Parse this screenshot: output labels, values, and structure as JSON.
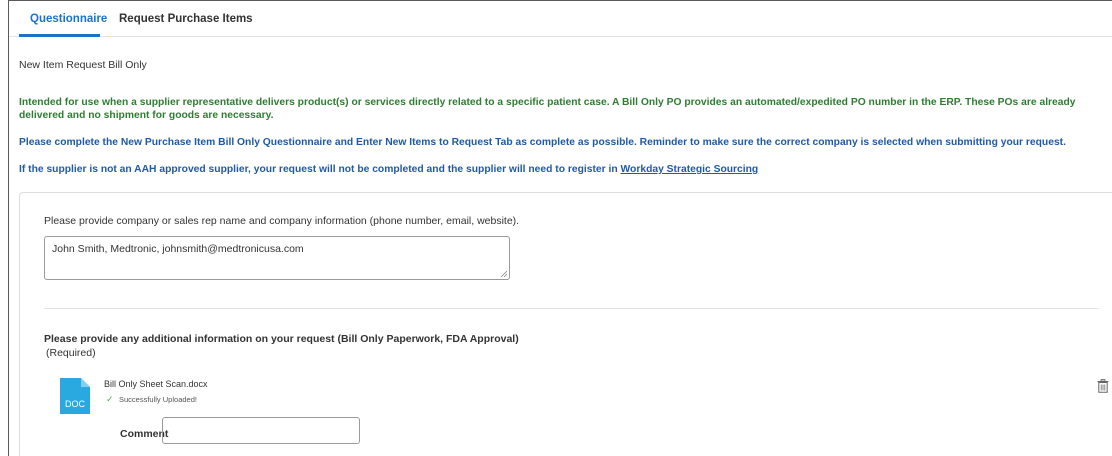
{
  "tabs": [
    {
      "label": "Questionnaire",
      "active": true
    },
    {
      "label": "Request Purchase Items",
      "active": false
    }
  ],
  "subtitle": "New Item Request Bill Only",
  "notices": {
    "intended_use": "Intended for use when a supplier representative delivers product(s) or services directly related to a specific patient case. A Bill Only PO provides an automated/expedited PO number in the ERP. These POs are already delivered and no shipment for goods are necessary.",
    "complete": "Please complete the New Purchase Item Bill Only Questionnaire and Enter New Items to Request Tab as complete as possible. Reminder to make sure the correct company is selected when submitting your request.",
    "supplier_prefix": "If the supplier is not an AAH approved supplier, your request will not be completed and the supplier will need to register in ",
    "supplier_link": "Workday Strategic Sourcing"
  },
  "question1": {
    "label": "Please provide company or sales rep name and company information (phone number, email, website).",
    "value": "John Smith, Medtronic, johnsmith@medtronicusa.com"
  },
  "question2": {
    "label": "Please provide any additional information on your request (Bill Only Paperwork, FDA Approval)",
    "required": "(Required)",
    "attachment": {
      "file_type": "DOC",
      "file_name": "Bill Only Sheet Scan.docx",
      "status": "Successfully Uploaded!"
    },
    "comment_label": "Comment",
    "comment_value": ""
  },
  "colors": {
    "accent": "#1a73c8",
    "green_text": "#2e7d32",
    "blue_text": "#1f5aa6",
    "doc_icon": "#29a9e0",
    "success": "#4caf50"
  },
  "icons": [
    "doc-file-icon",
    "check-icon",
    "trash-icon"
  ]
}
